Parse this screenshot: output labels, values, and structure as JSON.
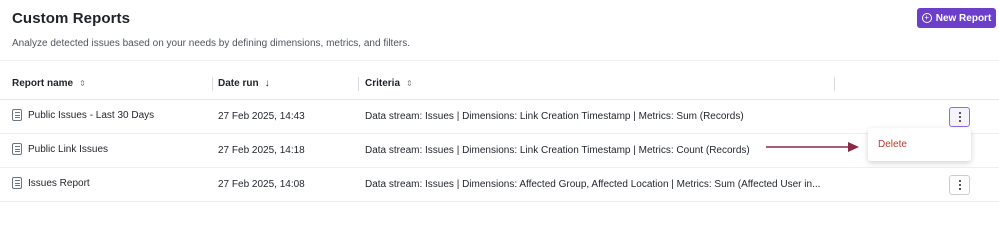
{
  "header": {
    "title": "Custom Reports",
    "subtitle": "Analyze detected issues based on your needs by defining dimensions, metrics, and filters.",
    "new_report_label": "New Report"
  },
  "table": {
    "columns": [
      {
        "label": "Report name",
        "sort_icon": "sort-both-icon"
      },
      {
        "label": "Date run",
        "sort_icon": "arrow-down-icon"
      },
      {
        "label": "Criteria",
        "sort_icon": "sort-both-icon"
      }
    ],
    "rows": [
      {
        "name": "Public Issues - Last 30 Days",
        "date": "27 Feb 2025, 14:43",
        "criteria": "Data stream: Issues | Dimensions: Link Creation Timestamp | Metrics: Sum (Records)"
      },
      {
        "name": "Public Link Issues",
        "date": "27 Feb 2025, 14:18",
        "criteria": "Data stream: Issues | Dimensions: Link Creation Timestamp | Metrics: Count (Records)"
      },
      {
        "name": "Issues Report",
        "date": "27 Feb 2025, 14:08",
        "criteria": "Data stream: Issues | Dimensions: Affected Group, Affected Location | Metrics: Sum (Affected User in..."
      }
    ]
  },
  "context_menu": {
    "delete_label": "Delete"
  },
  "colors": {
    "accent": "#6b3fc9",
    "danger": "#c0392b",
    "arrow": "#8b2846"
  }
}
